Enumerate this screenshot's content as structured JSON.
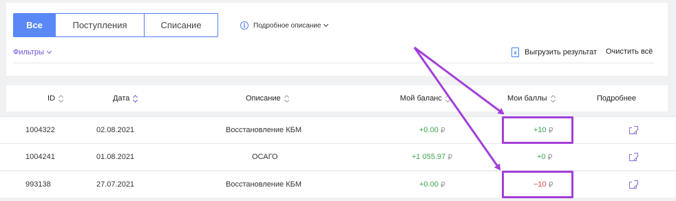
{
  "tabs": [
    {
      "label": "Все",
      "active": true
    },
    {
      "label": "Поступления",
      "active": false
    },
    {
      "label": "Списание",
      "active": false
    }
  ],
  "detail_toggle": {
    "label": "Подробное описание",
    "icon": "info-icon"
  },
  "filters": {
    "label": "Фильтры"
  },
  "actions": {
    "export_label": "Выгрузить результат",
    "clear_label": "Очистить всё"
  },
  "table": {
    "columns": [
      "ID",
      "Дата",
      "Описание",
      "Мой баланс",
      "Мои баллы",
      "Подробнее"
    ],
    "rows": [
      {
        "id": "1004322",
        "date": "02.08.2021",
        "description": "Восстановление КБМ",
        "balance": "+0.00",
        "points": "+10",
        "points_sign": "positive"
      },
      {
        "id": "1004241",
        "date": "01.08.2021",
        "description": "ОСАГО",
        "balance": "+1 055.97",
        "points": "+0",
        "points_sign": "positive"
      },
      {
        "id": "993138",
        "date": "27.07.2021",
        "description": "Восстановление КБМ",
        "balance": "+0.00",
        "points": "−10",
        "points_sign": "negative"
      }
    ],
    "currency": "₽"
  },
  "colors": {
    "accent": "#5a88f7",
    "link": "#6b4fd6",
    "positive": "#3aa64a",
    "negative": "#e04040",
    "annotation": "#a23ed8"
  }
}
